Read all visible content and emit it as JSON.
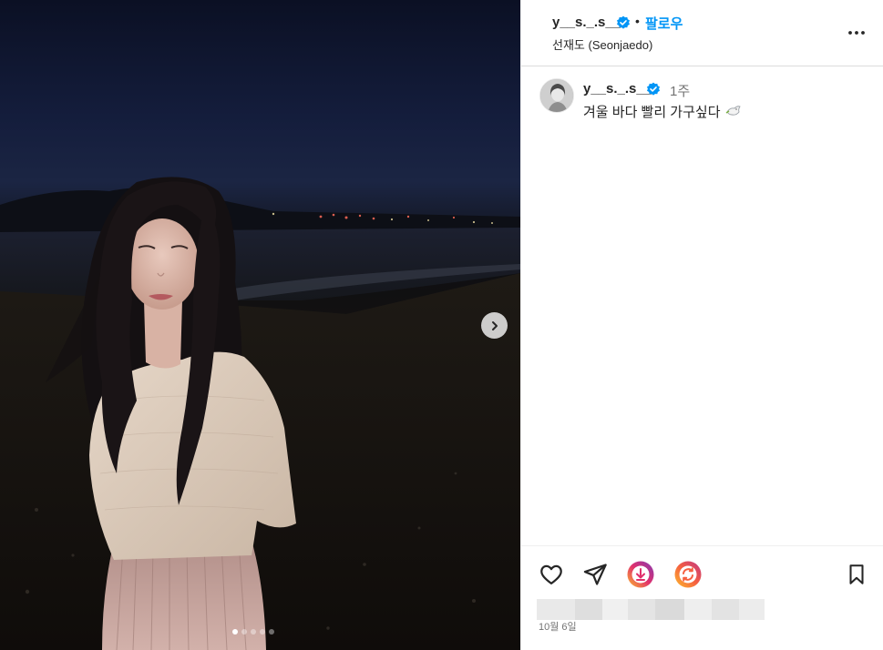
{
  "post": {
    "username": "y__s._.s__",
    "verified": true,
    "separator": "•",
    "follow_label": "팔로우",
    "location": "선재도 (Seonjaedo)",
    "more_icon": "more-horizontal-icon"
  },
  "caption": {
    "username": "y__s._.s__",
    "time_ago": "1주",
    "text": "겨울 바다 빨리 가구싶다",
    "emoji": "dove-emoji"
  },
  "media": {
    "next_icon": "chevron-right-icon",
    "slide_count": 5,
    "active_slide": 1
  },
  "actions": {
    "like_icon": "heart-icon",
    "share_icon": "send-icon",
    "download_icon": "download-extension-icon",
    "repost_icon": "repost-extension-icon",
    "save_icon": "bookmark-icon"
  },
  "date": "10월 6일",
  "colors": {
    "accent": "#0095f6",
    "text": "#262626",
    "muted": "#737373",
    "border": "#dbdbdb"
  }
}
